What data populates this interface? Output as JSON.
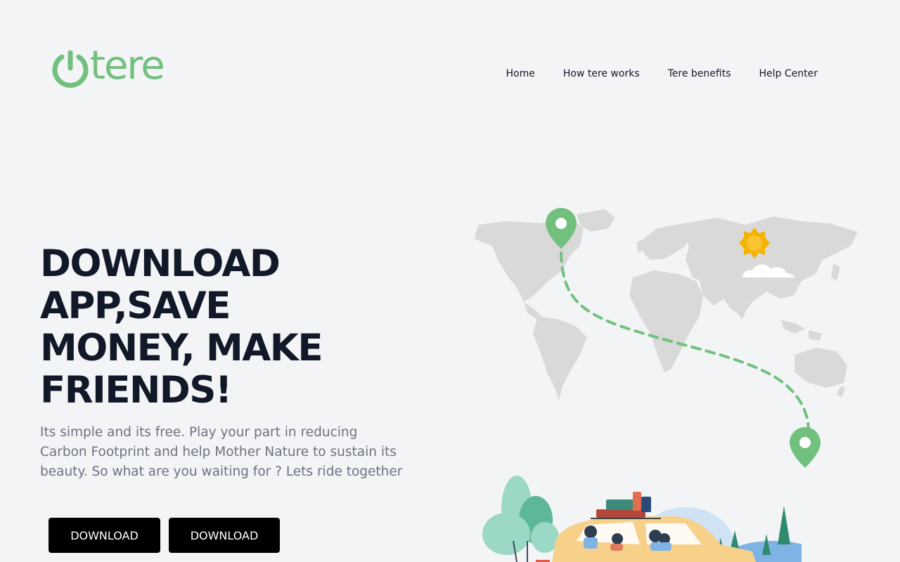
{
  "brand": {
    "name": "tere",
    "logo_icon": "power-icon",
    "accent_color": "#72c07e"
  },
  "nav": {
    "items": [
      {
        "label": "Home"
      },
      {
        "label": "How tere works"
      },
      {
        "label": "Tere benefits"
      },
      {
        "label": "Help Center"
      }
    ]
  },
  "hero": {
    "title": "DOWNLOAD APP,SAVE MONEY, MAKE FRIENDS!",
    "subtitle": "Its simple and its free. Play your part in reducing Carbon Footprint and help Mother Nature to sustain its beauty. So what are you waiting for ? Lets ride together",
    "buttons": [
      {
        "label": "DOWNLOAD"
      },
      {
        "label": "DOWNLOAD"
      }
    ]
  },
  "illustration": {
    "map_color": "#d9d9d9",
    "pin_color": "#72c07e",
    "sun_color": "#f5b400",
    "car_color": "#f7d08a"
  }
}
